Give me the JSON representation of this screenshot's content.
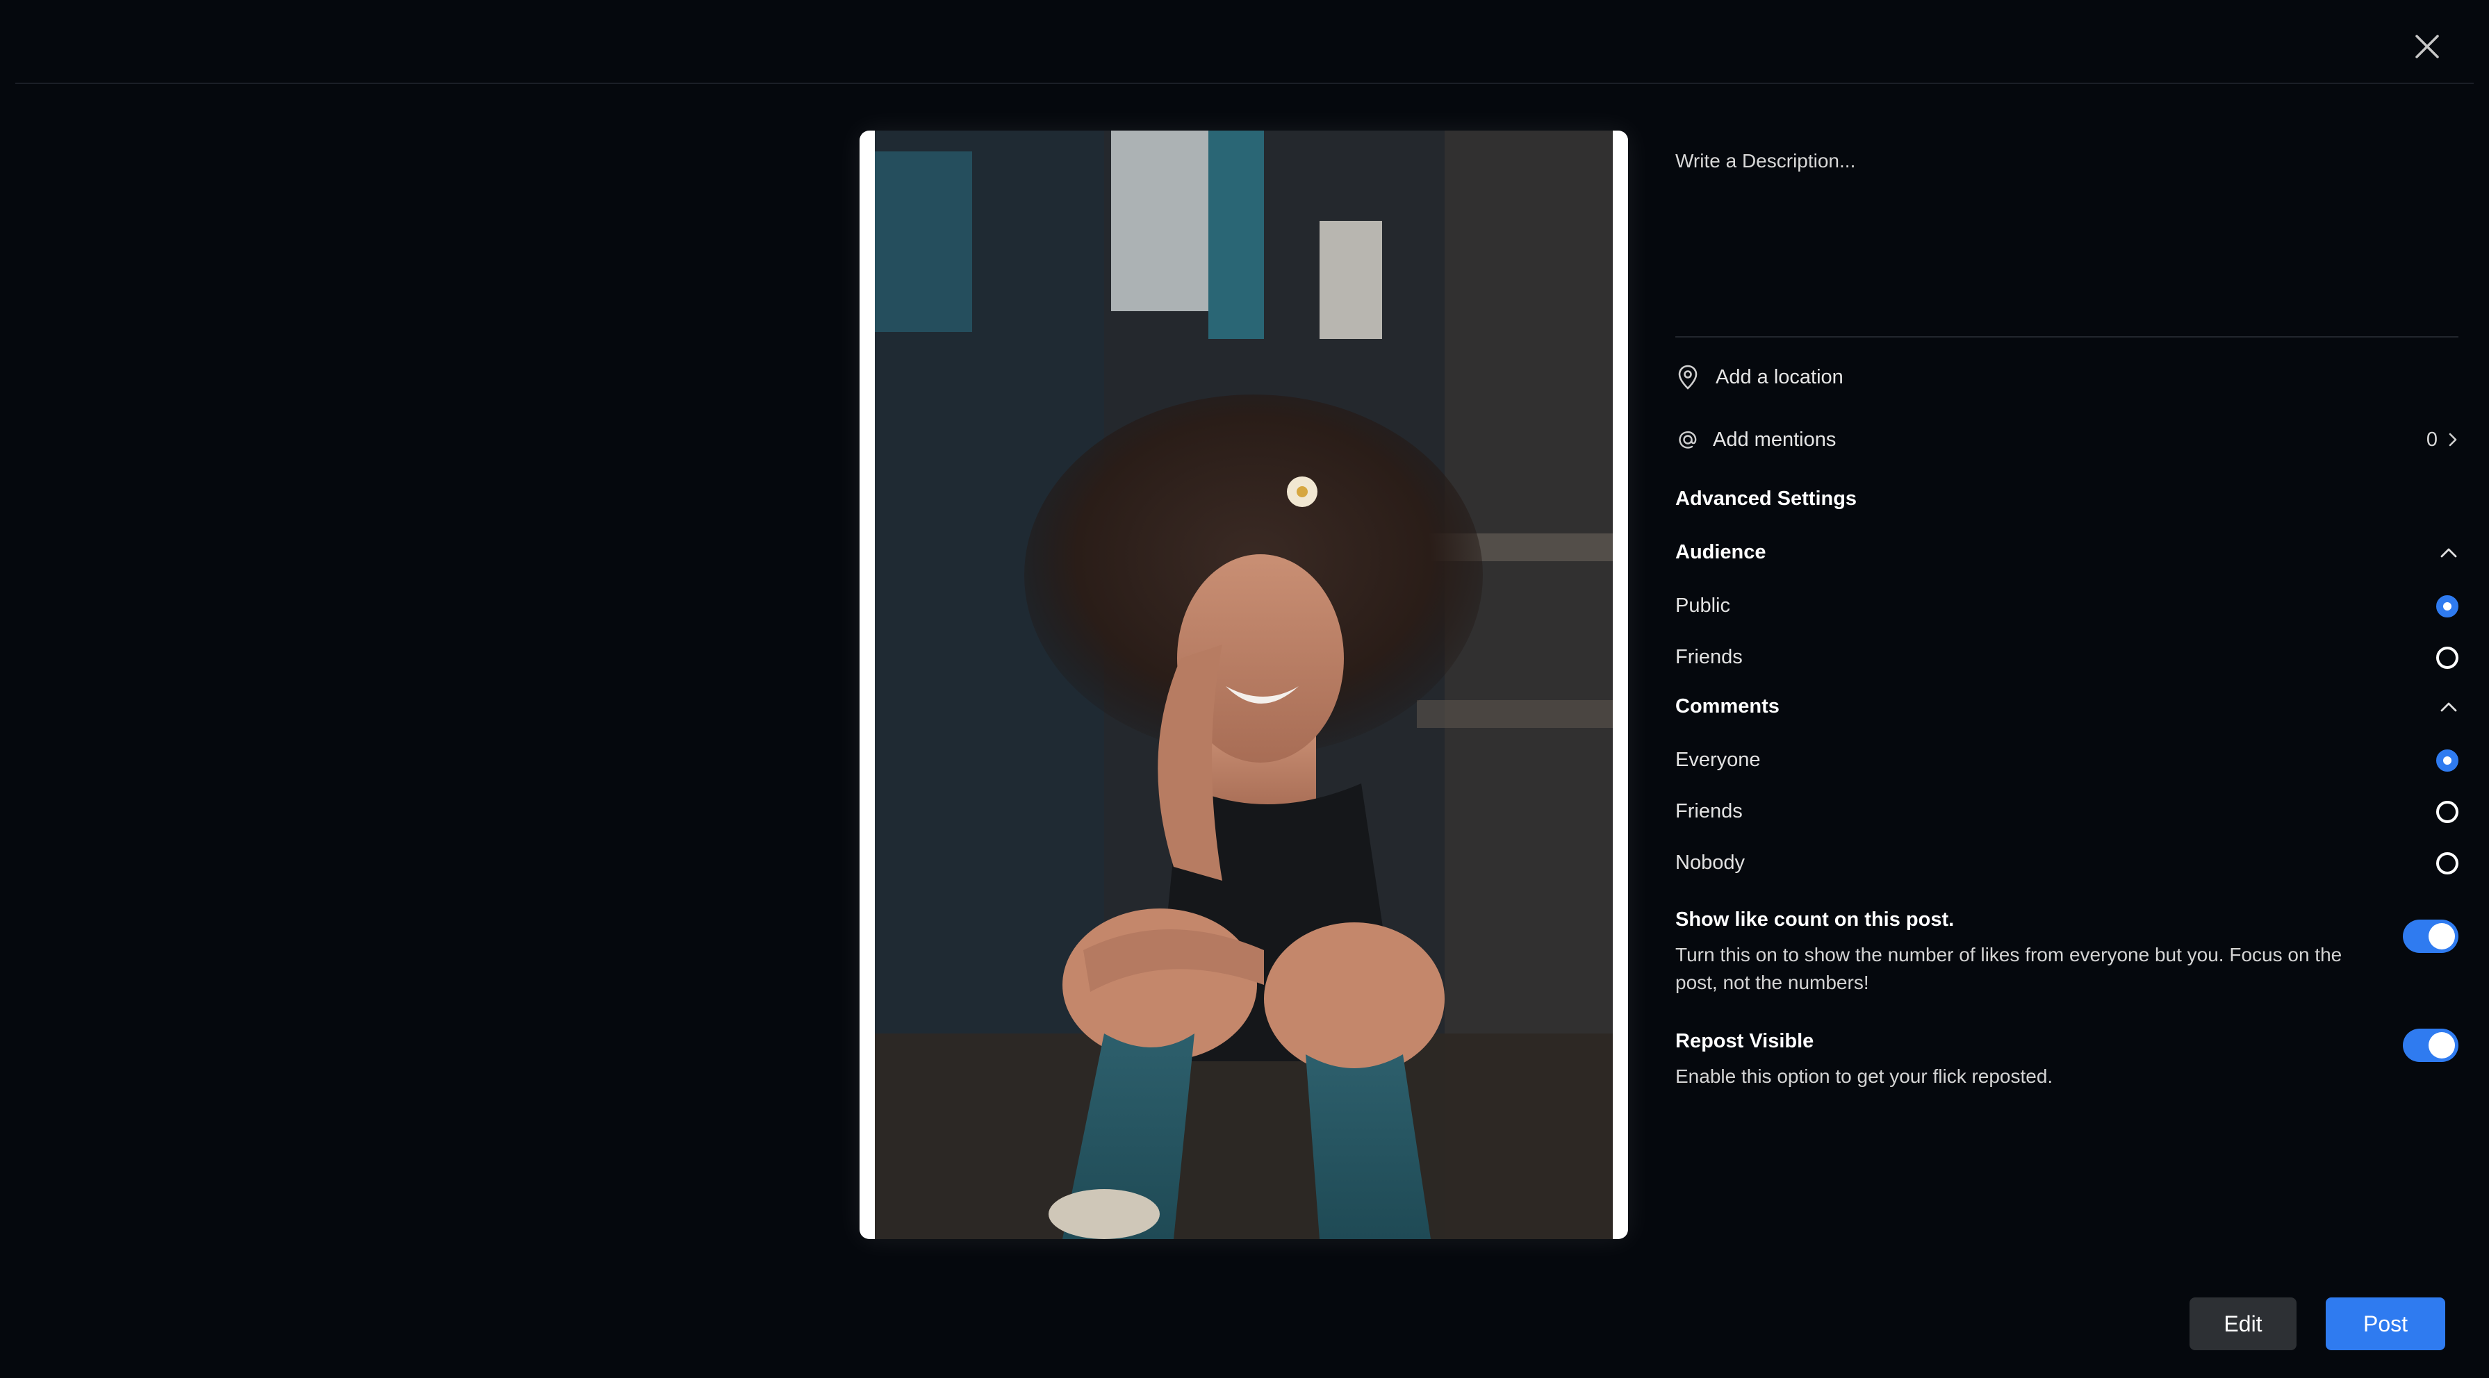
{
  "header": {
    "close_icon": "close-icon"
  },
  "media": {
    "image_subject": "photo"
  },
  "description": {
    "placeholder": "Write a Description..."
  },
  "location": {
    "icon": "location-pin-icon",
    "label": "Add a location"
  },
  "mentions": {
    "icon": "at-sign-icon",
    "label": "Add mentions",
    "count": "0"
  },
  "advanced_settings": {
    "title": "Advanced Settings"
  },
  "audience": {
    "title": "Audience",
    "options": [
      {
        "label": "Public",
        "selected": true
      },
      {
        "label": "Friends",
        "selected": false
      }
    ]
  },
  "comments": {
    "title": "Comments",
    "options": [
      {
        "label": "Everyone",
        "selected": true
      },
      {
        "label": "Friends",
        "selected": false
      },
      {
        "label": "Nobody",
        "selected": false
      }
    ]
  },
  "like_count": {
    "title": "Show like count on this post.",
    "description": "Turn this on to show the number of likes from everyone but you. Focus on the post, not the numbers!",
    "enabled": true
  },
  "repost": {
    "title": "Repost Visible",
    "description": "Enable this option to get your flick reposted.",
    "enabled": true
  },
  "actions": {
    "edit_label": "Edit",
    "post_label": "Post"
  },
  "colors": {
    "background": "#05080d",
    "accent": "#2f7bf0",
    "secondary_button": "#2d3034"
  }
}
